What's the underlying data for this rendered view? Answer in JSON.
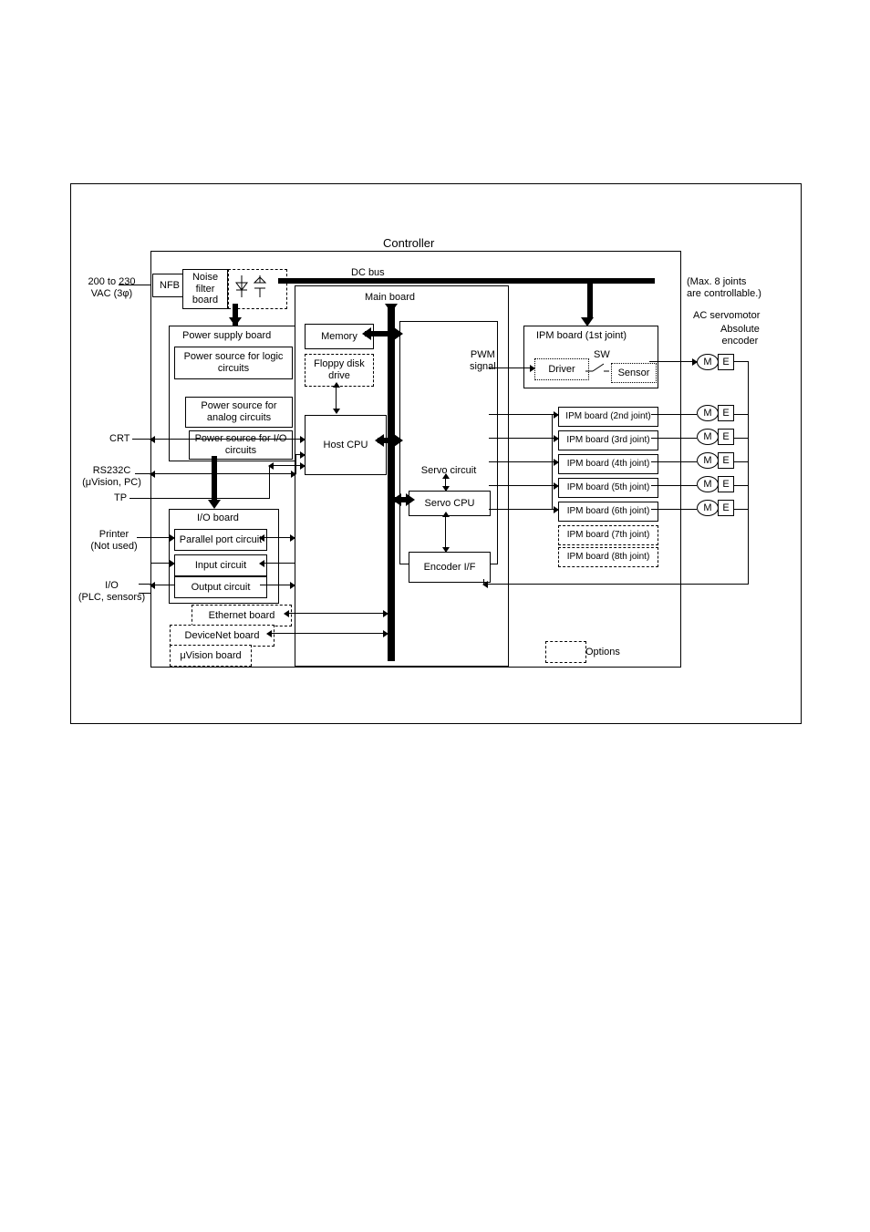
{
  "title": "Controller",
  "inputs": {
    "power": "200 to 230\nVAC (3φ)",
    "crt": "CRT",
    "rs232c": "RS232C\n(μVision, PC)",
    "tp": "TP",
    "printer": "Printer\n(Not used)",
    "io": "I/O\n(PLC, sensors)"
  },
  "top_row": {
    "nfb": "NFB",
    "noise_filter": "Noise\nfilter\nboard",
    "dc_bus": "DC bus"
  },
  "power_supply": {
    "title": "Power supply board",
    "logic": "Power source for\nlogic circuits",
    "analog": "Power source\nfor analog circuits",
    "io": "Power source\nfor I/O circuits"
  },
  "main": {
    "title": "Main board",
    "memory": "Memory",
    "floppy": "Floppy disk\ndrive",
    "host": "Host CPU",
    "servo_circuit": "Servo circuit",
    "servo_cpu": "Servo CPU",
    "encoder_if": "Encoder I/F",
    "pwm": "PWM\nsignal"
  },
  "io_board": {
    "title": "I/O board",
    "parallel": "Parallel port circuit",
    "input": "Input circuit",
    "output": "Output circuit"
  },
  "options_boards": {
    "ethernet": "Ethernet board",
    "devicenet": "DeviceNet board",
    "uvision": "μVision board",
    "options_key": "Options"
  },
  "ipm": {
    "first_title": "IPM board (1st joint)",
    "driver": "Driver",
    "sw": "SW",
    "sensor": "Sensor",
    "b2": "IPM board (2nd joint)",
    "b3": "IPM board (3rd joint)",
    "b4": "IPM board (4th joint)",
    "b5": "IPM board (5th joint)",
    "b6": "IPM board (6th joint)",
    "b7": "IPM board (7th joint)",
    "b8": "IPM board (8th joint)"
  },
  "right_notes": {
    "max": "(Max. 8 joints\nare controllable.)",
    "servomotor": "AC servomotor",
    "abs_encoder": "Absolute\nencoder"
  },
  "me": {
    "m": "M",
    "e": "E"
  }
}
